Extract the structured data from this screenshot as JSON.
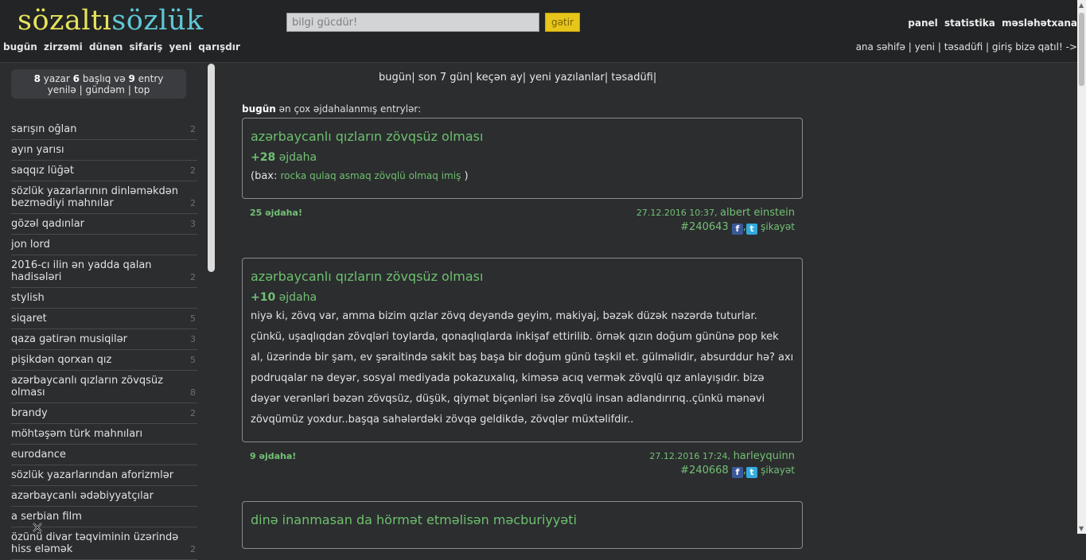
{
  "logo": {
    "part1": "sözaltı",
    "part2": "sözlük"
  },
  "subnav": [
    "bugün",
    "zirzəmi",
    "dünən",
    "sifariş",
    "yeni",
    "qarışdır"
  ],
  "search": {
    "placeholder": "bilgi gücdür!",
    "button": "gətir"
  },
  "topright": [
    "panel",
    "statistika",
    "məsləhətxana"
  ],
  "toplinks": [
    "ana səhifə",
    "yeni",
    "təsadüfi",
    "giriş",
    "bizə qatıl! ->"
  ],
  "stats": {
    "yazar": "8",
    "yazar_label": "yazar",
    "baslig": "6",
    "baslig_label": "başlıq və",
    "entry": "9",
    "entry_label": "entry",
    "links": [
      "yenilə",
      "gündəm",
      "top"
    ]
  },
  "sidebar": [
    {
      "label": "sarışın oğlan",
      "count": "2"
    },
    {
      "label": "ayın yarısı",
      "count": ""
    },
    {
      "label": "saqqız lüğət",
      "count": "2"
    },
    {
      "label": "sözlük yazarlarının dinləməkdən bezmədiyi mahnılar",
      "count": "2"
    },
    {
      "label": "gözəl qadınlar",
      "count": "3"
    },
    {
      "label": "jon lord",
      "count": ""
    },
    {
      "label": "2016-cı ilin ən yadda qalan hadisələri",
      "count": "2"
    },
    {
      "label": "stylish",
      "count": ""
    },
    {
      "label": "siqaret",
      "count": "5"
    },
    {
      "label": "qaza gətirən musiqilər",
      "count": "3"
    },
    {
      "label": "pişikdən qorxan qız",
      "count": "5"
    },
    {
      "label": "azərbaycanlı qızların zövqsüz olması",
      "count": "8"
    },
    {
      "label": "brandy",
      "count": "2"
    },
    {
      "label": "möhtəşəm türk mahnıları",
      "count": ""
    },
    {
      "label": "eurodance",
      "count": ""
    },
    {
      "label": "sözlük yazarlarından aforizmlər",
      "count": ""
    },
    {
      "label": "azərbaycanlı ədəbiyyatçılar",
      "count": ""
    },
    {
      "label": "a serbian film",
      "count": ""
    },
    {
      "label": "özünü divar təqviminin üzərində hiss eləmək",
      "count": "2"
    }
  ],
  "tabs": [
    "bugün",
    "son 7 gün",
    "keçən ay",
    "yeni yazılanlar",
    "təsadüfi"
  ],
  "section": {
    "bold": "bugün",
    "rest": "ən çox əjdahalanmış entrylər:"
  },
  "entries": [
    {
      "title": "azərbaycanlı qızların zövqsüz olması",
      "score": "+28",
      "score_label": "əjdaha",
      "bax_prefix": "(bax:",
      "bax_link": "rocka qulaq asmaq zövqlü olmaq imiş",
      "bax_suffix": ")",
      "votes": "25",
      "votes_label": "əjdaha!",
      "date": "27.12.2016 10:37,",
      "author": "albert einstein",
      "id": "#240643",
      "report": "şikayət"
    },
    {
      "title": "azərbaycanlı qızların zövqsüz olması",
      "score": "+10",
      "score_label": "əjdaha",
      "body": "niyə ki, zövq var, amma bizim qızlar zövq deyəndə geyim, makiyaj, bəzək düzək nəzərdə tuturlar. çünkü, uşaqlıqdan zövqləri toylarda, qonaqlıqlarda inkişaf ettirilib. örnək qızın doğum gününə pop kek al, üzərində bir şam, ev şəraitində sakit baş başa bir doğum günü təşkil et. gülməlidir, absurddur hə? axı podruqalar nə deyər, sosyal mediyada pokazuxalıq, kiməsə acıq vermək zövqlü qız anlayışıdır. bizə dəyər verənləri bəzən zövqsüz, düşük, qiymət biçənləri isə zövqlü insan adlandırırıq..çünkü mənəvi zövqümüz yoxdur..başqa sahələrdəki zövqə geldikdə, zövqlər müxtəlifdir..",
      "votes": "9",
      "votes_label": "əjdaha!",
      "date": "27.12.2016 17:24,",
      "author": "harleyquinn",
      "id": "#240668",
      "report": "şikayət"
    },
    {
      "title": "dinə inanmasan da hörmət etməlisən məcburiyyəti"
    }
  ],
  "icons": {
    "facebook": "facebook-icon",
    "twitter": "twitter-icon"
  },
  "colors": {
    "accent_green": "#6ec06e",
    "logo_yellow": "#e7e35a",
    "logo_cyan": "#5fc7d6",
    "button_yellow": "#e8c51a",
    "background": "#2b2d2f"
  }
}
